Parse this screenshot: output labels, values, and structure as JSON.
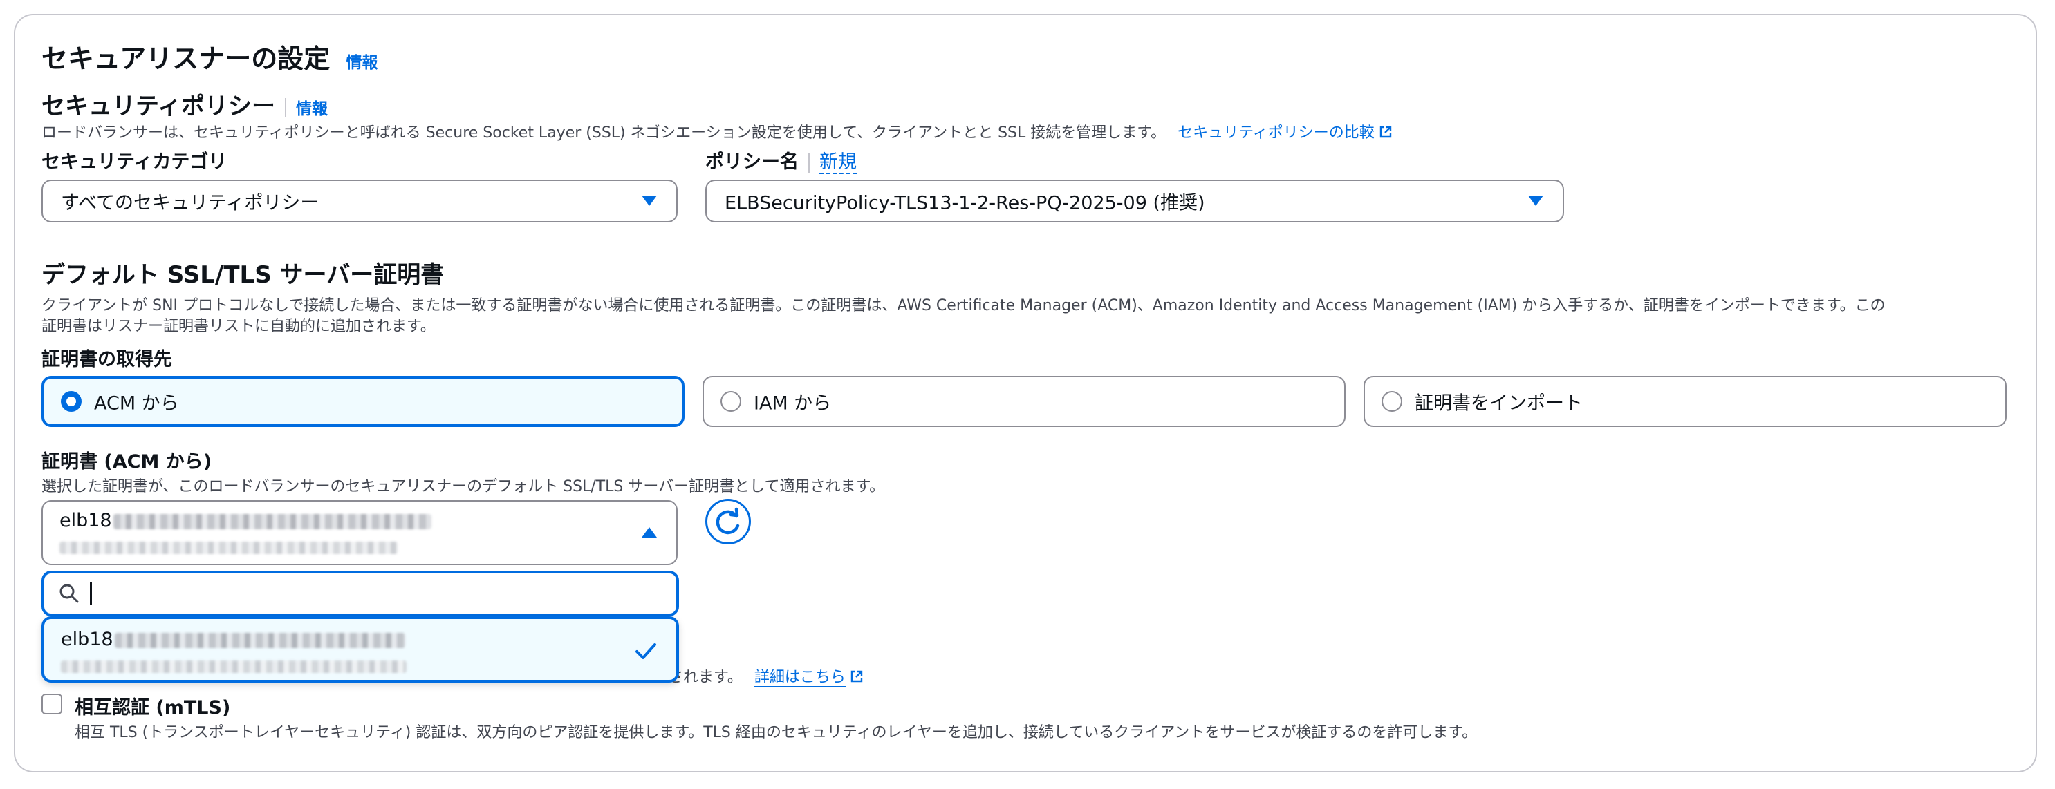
{
  "section": {
    "title": "セキュアリスナーの設定",
    "info_label": "情報"
  },
  "security_policy": {
    "title": "セキュリティポリシー",
    "info_label": "情報",
    "description": "ロードバランサーは、セキュリティポリシーと呼ばれる Secure Socket Layer (SSL) ネゴシエーション設定を使用して、クライアントとと SSL 接続を管理します。",
    "compare_link": "セキュリティポリシーの比較",
    "category_label": "セキュリティカテゴリ",
    "category_value": "すべてのセキュリティポリシー",
    "policy_name_label": "ポリシー名",
    "new_link": "新規",
    "policy_value": "ELBSecurityPolicy-TLS13-1-2-Res-PQ-2025-09 (推奨)"
  },
  "default_cert": {
    "title": "デフォルト SSL/TLS サーバー証明書",
    "description_line1": "クライアントが SNI プロトコルなしで接続した場合、または一致する証明書がない場合に使用される証明書。この証明書は、AWS Certificate Manager (ACM)、Amazon Identity and Access Management (IAM) から入手するか、証明書をインポートできます。この",
    "description_line2": "証明書はリスナー証明書リストに自動的に追加されます。",
    "source_label": "証明書の取得先",
    "sources": [
      {
        "label": "ACM から",
        "selected": true
      },
      {
        "label": "IAM から",
        "selected": false
      },
      {
        "label": "証明書をインポート",
        "selected": false
      }
    ],
    "cert_label": "証明書 (ACM から)",
    "cert_description": "選択した証明書が、このロードバランサーのセキュアリスナーのデフォルト SSL/TLS サーバー証明書として適用されます。",
    "selected_cert_prefix": "elb18",
    "search_value": "",
    "option_prefix": "elb18"
  },
  "partial_text": {
    "suffix": "されます。",
    "detail_link": "詳細はこちら"
  },
  "mtls": {
    "label": "相互認証 (mTLS)",
    "description": "相互 TLS (トランスポートレイヤーセキュリティ) 認証は、双方向のピア認証を提供します。TLS 経由のセキュリティのレイヤーを追加し、接続しているクライアントをサービスが検証するのを許可します。",
    "checked": false
  },
  "colors": {
    "accent": "#006ce0",
    "border": "#8c8c94",
    "selected_bg": "#f0fbff",
    "text": "#0f141a",
    "muted": "#424650"
  },
  "icons": [
    "external-link-icon",
    "caret-down-icon",
    "caret-up-icon",
    "refresh-icon",
    "search-icon",
    "check-icon"
  ]
}
